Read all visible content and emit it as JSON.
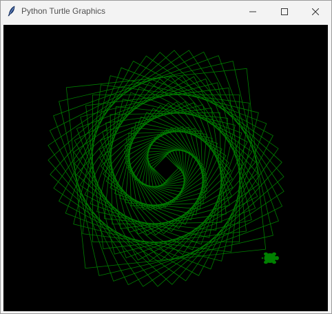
{
  "window": {
    "title": "Python Turtle Graphics",
    "icon": "feather-icon",
    "controls": {
      "minimize_icon": "minimize-icon",
      "maximize_icon": "maximize-icon",
      "close_icon": "close-icon"
    }
  },
  "canvas": {
    "background_color": "#000000",
    "pen_color": "#008000",
    "turtle_color": "#008000",
    "turtle_shape": "turtle-icon"
  }
}
